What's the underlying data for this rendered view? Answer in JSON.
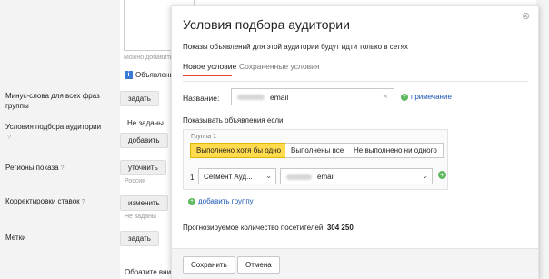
{
  "background": {
    "hint": "Можно добавить",
    "info": "Объявлени",
    "info_icon": "i",
    "rows": [
      {
        "label": "Минус-слова для всех фраз группы",
        "help": "",
        "button": "задать",
        "value": ""
      },
      {
        "label": "Условия подбора аудитории",
        "help": "?",
        "button": "добавить",
        "value": "Не заданы"
      },
      {
        "label": "Регионы показа",
        "help": "?",
        "button": "уточнить",
        "sub": "Россия"
      },
      {
        "label": "Корректировки ставок",
        "help": "?",
        "button": "изменить",
        "sub": "Не заданы"
      },
      {
        "label": "Метки",
        "help": "",
        "button": "задать"
      }
    ],
    "bottom_text": "Обратите вним"
  },
  "modal": {
    "title": "Условия подбора аудитории",
    "subtitle": "Показы объявлений для этой аудитории будут идти только в сетях",
    "tabs": [
      "Новое условие",
      "Сохраненные условия"
    ],
    "name_label": "Название:",
    "name_value": "email",
    "note_link": "примечание",
    "show_label": "Показывать объявления если:",
    "group": {
      "label": "Группа 1",
      "modes": [
        "Выполнено хотя бы одно",
        "Выполнены все",
        "Не выполнено ни одного"
      ],
      "selected_mode": "Выполнено хотя бы одно",
      "row_number": "1.",
      "condition_type": "Сегмент Ауд...",
      "condition_value": "email"
    },
    "add_group": "добавить группу",
    "forecast_label": "Прогнозируемое количество посетителей:",
    "forecast_value": "304 250",
    "save_button": "Сохранить",
    "cancel_button": "Отмена"
  },
  "colors": {
    "accent_tab": "#e8402f",
    "selected_mode": "#ffdb4d",
    "link": "#1a55b3",
    "add_icon": "#5cb85c"
  }
}
